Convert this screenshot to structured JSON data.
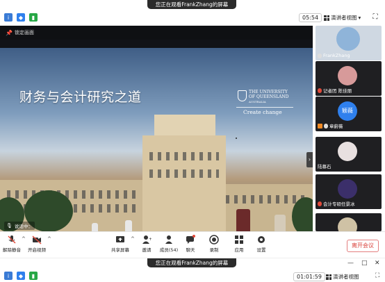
{
  "top_bar": {
    "share_banner": "您正在观看FrankZhang的屏幕",
    "timer": "05:54",
    "view_button": "演讲者视图"
  },
  "share": {
    "focus_label": "锁定画面",
    "speaking_label": "说话中：",
    "slide_title": "财务与会计研究之道",
    "uq_name_line1": "THE UNIVERSITY",
    "uq_name_line2": "OF QUEENSLAND",
    "uq_name_line3": "AUSTRALIA",
    "uq_tagline": "Create change"
  },
  "participants": [
    {
      "name": "FrankZhang",
      "avatar_color": "#8fb4d9",
      "muted": false
    },
    {
      "name": "记者团 陈佳丽",
      "avatar_color": "#d79a9a",
      "muted": true
    },
    {
      "name": "章蔚薇",
      "avatar_text": "颖薇",
      "muted": false,
      "host": true
    },
    {
      "name": "陆慕石",
      "avatar_color": "#e8e0e0",
      "muted": false
    },
    {
      "name": "会计专硕任景冰",
      "avatar_color": "#3b2f6a",
      "muted": true
    },
    {
      "name": "",
      "avatar_color": "#cfc2a5",
      "muted": false
    }
  ],
  "toolbar": {
    "mute": "解除静音",
    "video": "开启视频",
    "share_screen": "共享屏幕",
    "invite": "邀请",
    "members": "成员(54)",
    "chat": "聊天",
    "record": "录制",
    "apps": "应用",
    "settings": "设置",
    "leave": "离开会议"
  },
  "mini_bar": {
    "share_banner": "您正在观看FrankZhang的屏幕",
    "timer": "01:01:59",
    "view_button": "演讲者视图"
  },
  "colors": {
    "accent_blue": "#2f80ed",
    "leave_red": "#d9413a",
    "panel_tile": "#1f1f22"
  }
}
